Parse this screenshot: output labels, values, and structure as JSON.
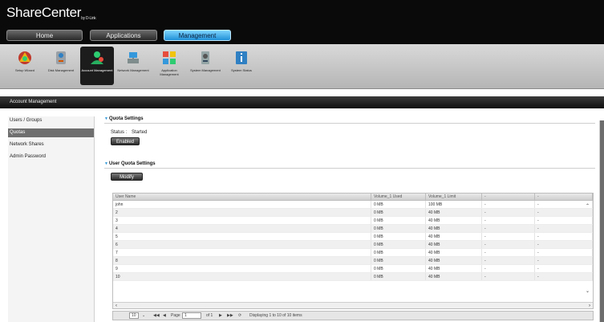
{
  "brand": {
    "name": "ShareCenter",
    "sub": "by D-Link"
  },
  "nav_tabs": [
    {
      "label": "Home"
    },
    {
      "label": "Applications"
    },
    {
      "label": "Management"
    }
  ],
  "toolbar": [
    {
      "label": "Setup Wizard",
      "icon": "wizard-icon"
    },
    {
      "label": "Disk Management",
      "icon": "disk-icon"
    },
    {
      "label": "Account Management",
      "icon": "account-icon",
      "active": true
    },
    {
      "label": "Network Management",
      "icon": "network-icon"
    },
    {
      "label": "Application Management",
      "icon": "application-icon"
    },
    {
      "label": "System Management",
      "icon": "system-icon"
    },
    {
      "label": "System Status",
      "icon": "info-icon"
    }
  ],
  "section_title": "Account Management",
  "sidebar": [
    {
      "label": "Users / Groups"
    },
    {
      "label": "Quotas",
      "active": true
    },
    {
      "label": "Network Shares"
    },
    {
      "label": "Admin Password"
    }
  ],
  "quota_settings": {
    "title": "Quota Settings",
    "status_label": "Status :",
    "status_value": "Started",
    "button": "Enabled"
  },
  "user_quota": {
    "title": "User Quota Settings",
    "modify_button": "Modify",
    "columns": [
      "User Name",
      "Volume_1  Used",
      "Volume_1  Limit",
      "-",
      "-"
    ],
    "rows": [
      [
        "john",
        "0 MB",
        "100 MB",
        "-",
        "-"
      ],
      [
        "2",
        "0 MB",
        "40 MB",
        "-",
        "-"
      ],
      [
        "3",
        "0 MB",
        "40 MB",
        "-",
        "-"
      ],
      [
        "4",
        "0 MB",
        "40 MB",
        "-",
        "-"
      ],
      [
        "5",
        "0 MB",
        "40 MB",
        "-",
        "-"
      ],
      [
        "6",
        "0 MB",
        "40 MB",
        "-",
        "-"
      ],
      [
        "7",
        "0 MB",
        "40 MB",
        "-",
        "-"
      ],
      [
        "8",
        "0 MB",
        "40 MB",
        "-",
        "-"
      ],
      [
        "9",
        "0 MB",
        "40 MB",
        "-",
        "-"
      ],
      [
        "10",
        "0 MB",
        "40 MB",
        "-",
        "-"
      ]
    ]
  },
  "pager": {
    "page_size": "10",
    "page_label": "Page",
    "page_value": "1",
    "of_label": "of 1",
    "display_text": "Displaying 1 to 10 of 10 items"
  }
}
